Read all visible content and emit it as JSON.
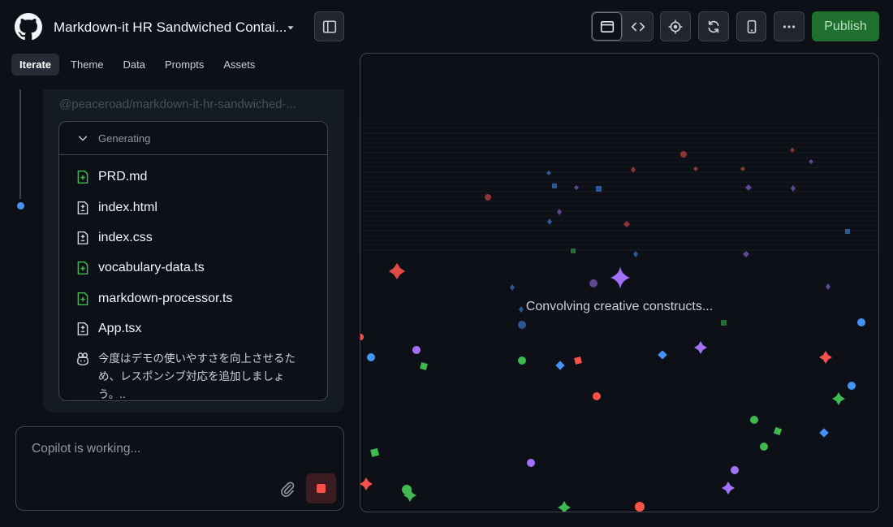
{
  "header": {
    "title": "Markdown-it HR Sandwiched Contai...",
    "publish_label": "Publish"
  },
  "tabs": [
    {
      "label": "Iterate",
      "active": true
    },
    {
      "label": "Theme",
      "active": false
    },
    {
      "label": "Data",
      "active": false
    },
    {
      "label": "Prompts",
      "active": false
    },
    {
      "label": "Assets",
      "active": false
    }
  ],
  "chat": {
    "mention": "@peaceroad/markdown-it-hr-sandwiched-...",
    "generating_label": "Generating",
    "files": [
      {
        "name": "PRD.md",
        "icon": "file-added-icon",
        "status": "added"
      },
      {
        "name": "index.html",
        "icon": "file-diff-icon",
        "status": "modified"
      },
      {
        "name": "index.css",
        "icon": "file-diff-icon",
        "status": "modified"
      },
      {
        "name": "vocabulary-data.ts",
        "icon": "file-added-icon",
        "status": "added"
      },
      {
        "name": "markdown-processor.ts",
        "icon": "file-added-icon",
        "status": "added"
      },
      {
        "name": "App.tsx",
        "icon": "file-diff-icon",
        "status": "modified"
      }
    ],
    "copilot_note": "今度はデモの使いやすさを向上させるため、レスポンシブ対応を追加しましょう。.."
  },
  "composer": {
    "placeholder": "Copilot is working..."
  },
  "preview": {
    "status_text": "Convolving creative constructs..."
  },
  "colors": {
    "accent_green": "#3fb950",
    "accent_blue": "#4493f8",
    "accent_purple": "#a371f7",
    "accent_red": "#f85149",
    "publish_bg": "#1f6f2f"
  }
}
